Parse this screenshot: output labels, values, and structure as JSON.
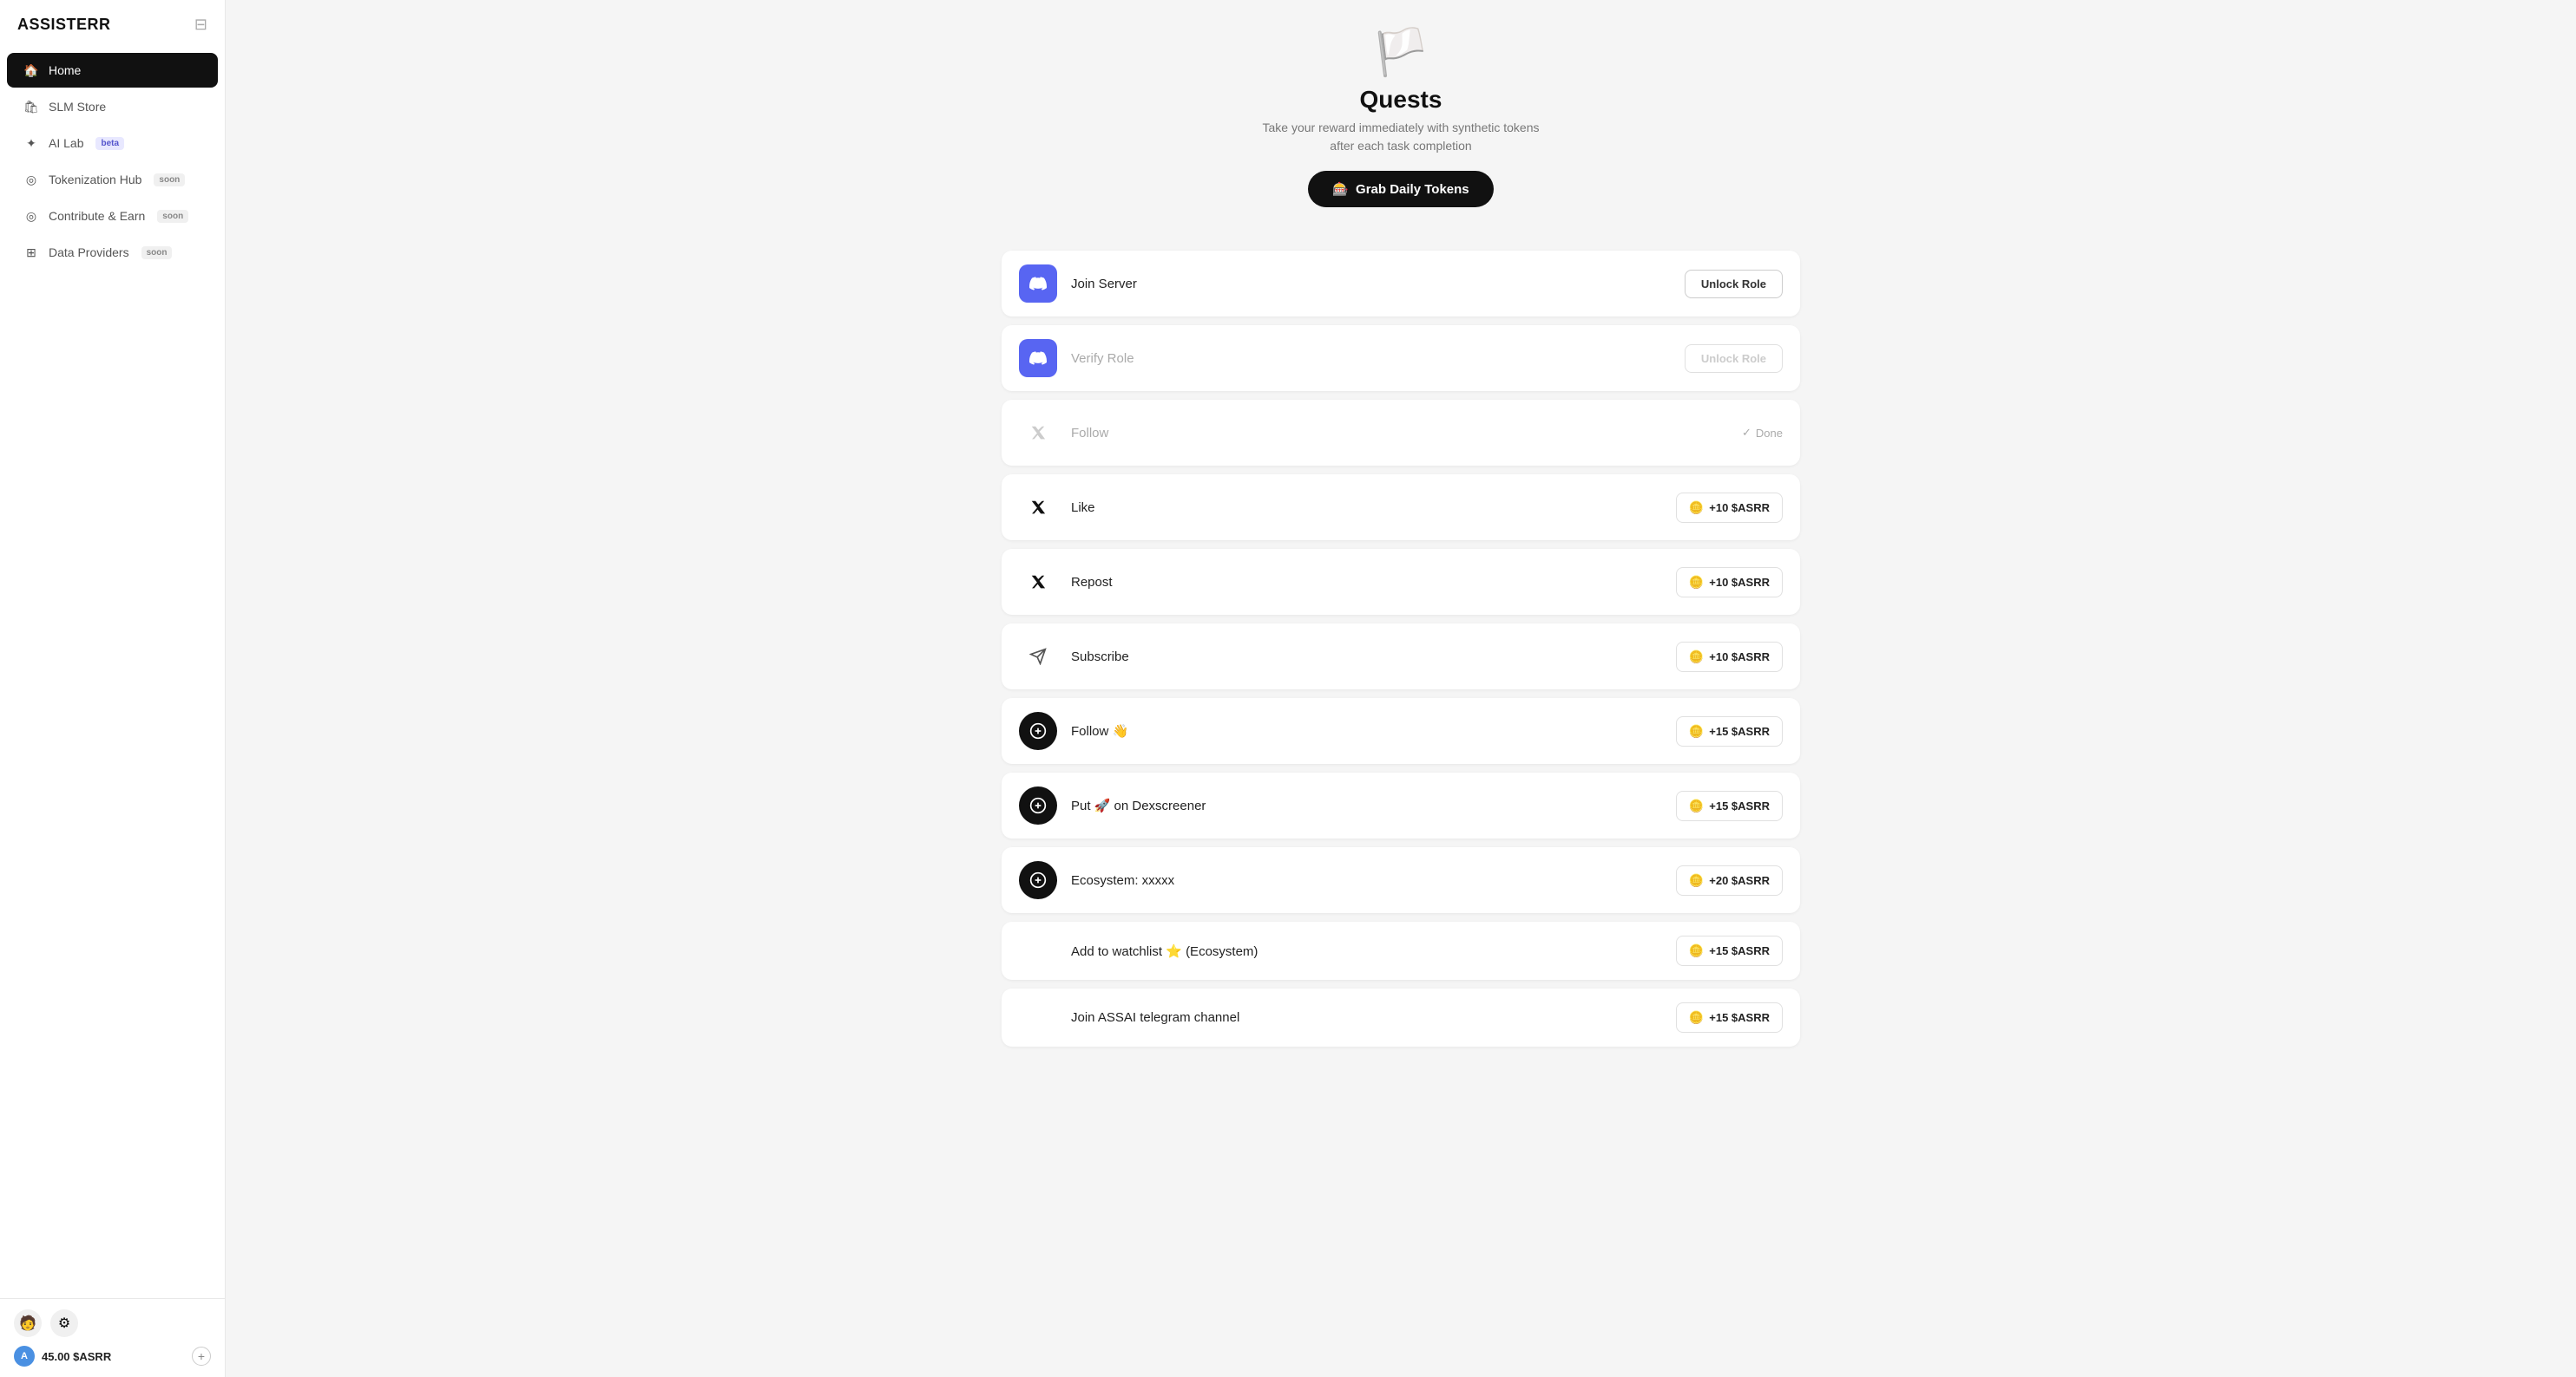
{
  "app": {
    "name": "ASSISTERR"
  },
  "sidebar": {
    "toggle_label": "⊟",
    "nav_items": [
      {
        "id": "home",
        "label": "Home",
        "icon": "🏠",
        "active": true,
        "badge": null
      },
      {
        "id": "slm-store",
        "label": "SLM Store",
        "icon": "🛍",
        "active": false,
        "badge": null
      },
      {
        "id": "ai-lab",
        "label": "AI Lab",
        "icon": "✦",
        "active": false,
        "badge": "beta",
        "badge_type": "beta"
      },
      {
        "id": "tokenization-hub",
        "label": "Tokenization Hub",
        "icon": "◎",
        "active": false,
        "badge": "soon",
        "badge_type": "soon"
      },
      {
        "id": "contribute-earn",
        "label": "Contribute & Earn",
        "icon": "◎",
        "active": false,
        "badge": "soon",
        "badge_type": "soon"
      },
      {
        "id": "data-providers",
        "label": "Data Providers",
        "icon": "⊞",
        "active": false,
        "badge": "soon",
        "badge_type": "soon"
      }
    ],
    "footer": {
      "avatar_emoji": "🧑",
      "settings_icon": "⚙",
      "wallet_letter": "A",
      "balance": "45.00 $ASRR",
      "add_icon": "+"
    }
  },
  "quests": {
    "hero": {
      "flag_emoji": "🏳",
      "title": "Quests",
      "subtitle": "Take your reward immediately with synthetic tokens after each task completion",
      "grab_btn_icon": "🎰",
      "grab_btn_label": "Grab Daily Tokens"
    },
    "items": [
      {
        "id": "join-server",
        "icon_type": "discord",
        "icon_char": "💬",
        "label": "Join Server",
        "action_type": "unlock",
        "action_label": "Unlock Role",
        "muted": false
      },
      {
        "id": "verify-role",
        "icon_type": "discord",
        "icon_char": "💬",
        "label": "Verify Role",
        "action_type": "unlock-muted",
        "action_label": "Unlock Role",
        "muted": true
      },
      {
        "id": "follow-x",
        "icon_type": "x",
        "icon_char": "✕",
        "label": "Follow",
        "action_type": "done",
        "action_label": "Done",
        "muted": true
      },
      {
        "id": "like-x",
        "icon_type": "x",
        "icon_char": "✕",
        "label": "Like",
        "action_type": "reward",
        "reward": "+10 $ASRR",
        "muted": false
      },
      {
        "id": "repost-x",
        "icon_type": "x",
        "icon_char": "✕",
        "label": "Repost",
        "action_type": "reward",
        "reward": "+10 $ASRR",
        "muted": false
      },
      {
        "id": "subscribe",
        "icon_type": "x-send",
        "icon_char": "➤",
        "label": "Subscribe",
        "action_type": "reward",
        "reward": "+10 $ASRR",
        "muted": false
      },
      {
        "id": "follow-emoji",
        "icon_type": "black-circle",
        "icon_char": "⊕",
        "label": "Follow 👋",
        "action_type": "reward",
        "reward": "+15 $ASRR",
        "muted": false
      },
      {
        "id": "put-dexscreener",
        "icon_type": "black-circle",
        "icon_char": "⊕",
        "label": "Put 🚀 on Dexscreener",
        "action_type": "reward",
        "reward": "+15 $ASRR",
        "muted": false
      },
      {
        "id": "ecosystem",
        "icon_type": "black-circle",
        "icon_char": "⊕",
        "label": "Ecosystem: xxxxx",
        "action_type": "reward",
        "reward": "+20 $ASRR",
        "muted": false
      },
      {
        "id": "add-watchlist",
        "icon_type": "none",
        "icon_char": "",
        "label": "Add to watchlist ⭐ (Ecosystem)",
        "action_type": "reward",
        "reward": "+15 $ASRR",
        "muted": false,
        "no_icon": true
      },
      {
        "id": "join-telegram",
        "icon_type": "none",
        "icon_char": "",
        "label": "Join ASSAI telegram channel",
        "action_type": "reward",
        "reward": "+15 $ASRR",
        "muted": false,
        "no_icon": true
      }
    ]
  }
}
